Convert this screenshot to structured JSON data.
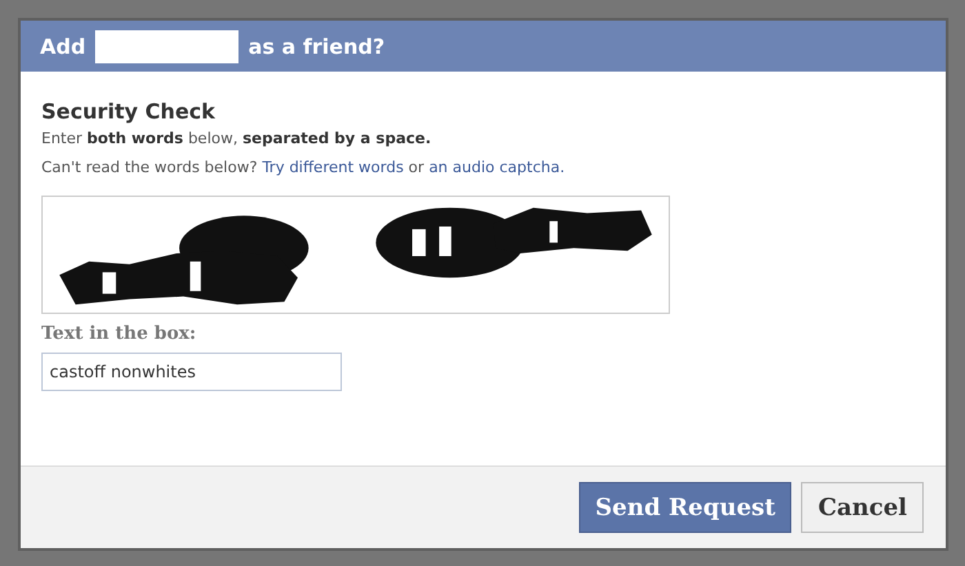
{
  "dialog": {
    "title": {
      "before": "Add",
      "redacted": true,
      "after": "as a friend?"
    },
    "heading": "Security Check",
    "instructions": "Enter **both words** below, **separated by a space.**",
    "help": [
      {
        "kind": "text",
        "text": "Can't read the words below? "
      },
      {
        "kind": "link",
        "text": "Try different words"
      },
      {
        "kind": "text",
        "text": " or "
      },
      {
        "kind": "link",
        "text": "an audio captcha."
      }
    ],
    "field": {
      "label": "Text in the box:",
      "value": "castoff nonwhites"
    },
    "buttons": [
      {
        "label": "Send Request",
        "kind": "primary"
      },
      {
        "label": "Cancel",
        "kind": "secondary"
      }
    ]
  }
}
